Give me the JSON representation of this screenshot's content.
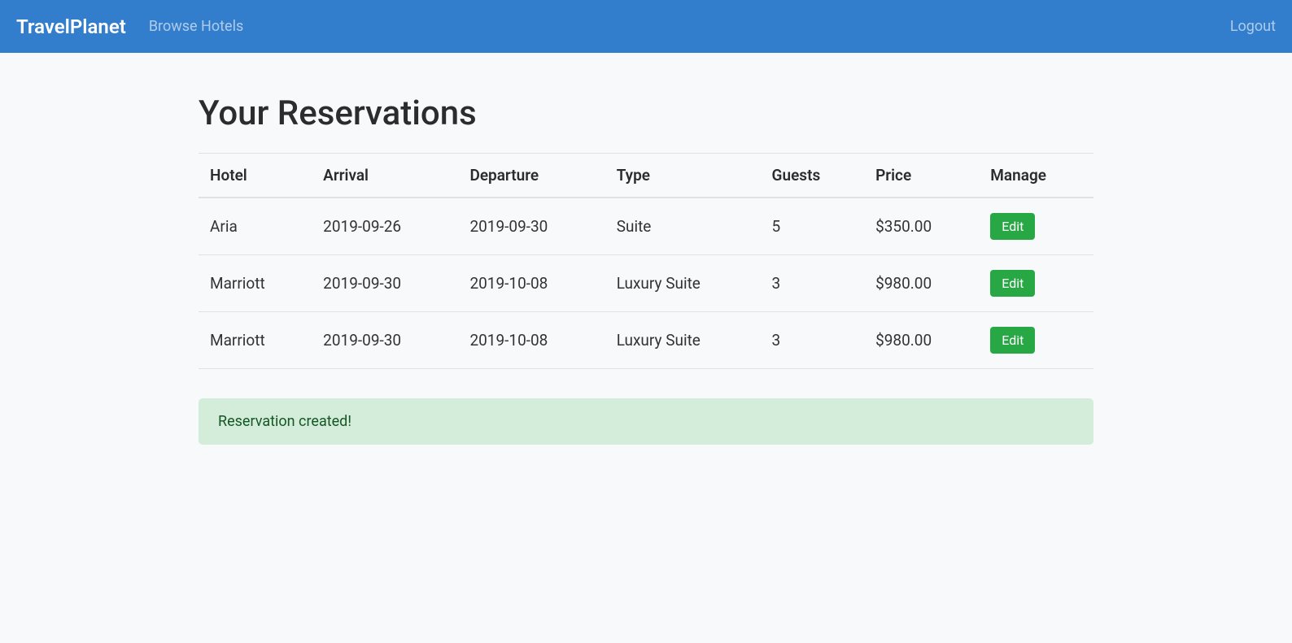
{
  "navbar": {
    "brand": "TravelPlanet",
    "browse_hotels": "Browse Hotels",
    "logout": "Logout"
  },
  "page": {
    "title": "Your Reservations"
  },
  "table": {
    "headers": {
      "hotel": "Hotel",
      "arrival": "Arrival",
      "departure": "Departure",
      "type": "Type",
      "guests": "Guests",
      "price": "Price",
      "manage": "Manage"
    },
    "rows": [
      {
        "hotel": "Aria",
        "arrival": "2019-09-26",
        "departure": "2019-09-30",
        "type": "Suite",
        "guests": "5",
        "price": "$350.00",
        "edit_label": "Edit"
      },
      {
        "hotel": "Marriott",
        "arrival": "2019-09-30",
        "departure": "2019-10-08",
        "type": "Luxury Suite",
        "guests": "3",
        "price": "$980.00",
        "edit_label": "Edit"
      },
      {
        "hotel": "Marriott",
        "arrival": "2019-09-30",
        "departure": "2019-10-08",
        "type": "Luxury Suite",
        "guests": "3",
        "price": "$980.00",
        "edit_label": "Edit"
      }
    ]
  },
  "alert": {
    "message": "Reservation created!"
  }
}
